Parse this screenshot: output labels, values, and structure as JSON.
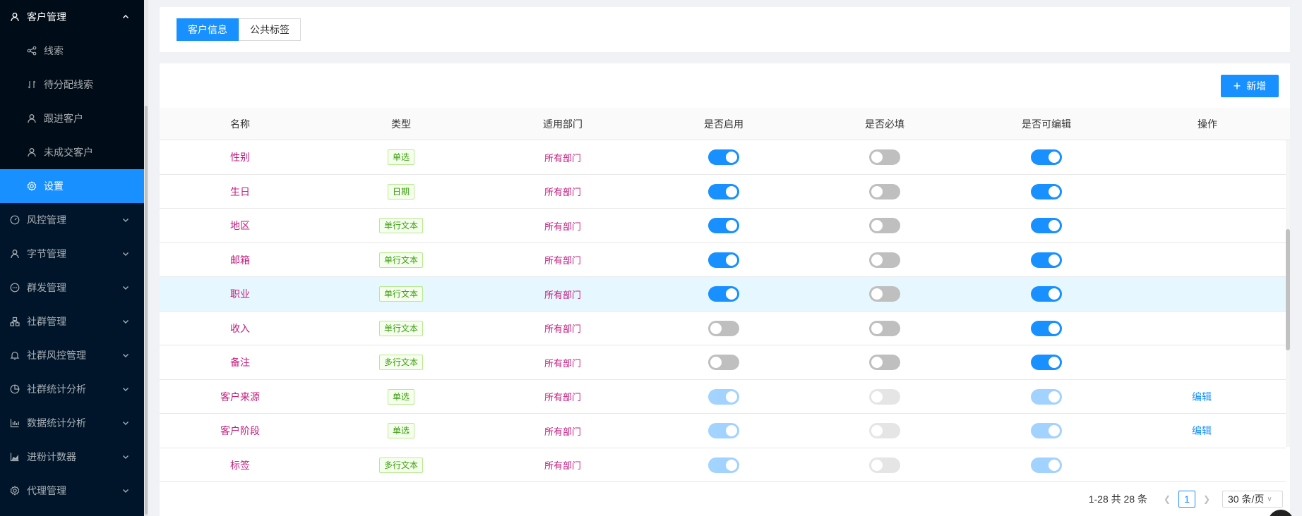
{
  "sidebar": {
    "items": [
      {
        "label": "客户管理",
        "icon": "customer-icon",
        "expanded": true
      },
      {
        "label": "线索",
        "icon": "share-icon"
      },
      {
        "label": "待分配线索",
        "icon": "swap-icon"
      },
      {
        "label": "跟进客户",
        "icon": "user-icon"
      },
      {
        "label": "未成交客户",
        "icon": "user-icon"
      },
      {
        "label": "设置",
        "icon": "gear-icon",
        "active": true
      },
      {
        "label": "风控管理",
        "icon": "dashboard-icon"
      },
      {
        "label": "字节管理",
        "icon": "user-icon"
      },
      {
        "label": "群发管理",
        "icon": "message-icon"
      },
      {
        "label": "社群管理",
        "icon": "group-icon"
      },
      {
        "label": "社群风控管理",
        "icon": "bell-icon"
      },
      {
        "label": "社群统计分析",
        "icon": "pie-chart-icon"
      },
      {
        "label": "数据统计分析",
        "icon": "bar-chart-icon"
      },
      {
        "label": "进粉计数器",
        "icon": "area-chart-icon"
      },
      {
        "label": "代理管理",
        "icon": "gear-icon"
      }
    ]
  },
  "tabs": {
    "customer_info": "客户信息",
    "public_tags": "公共标签"
  },
  "toolbar": {
    "add_label": "新增",
    "add_icon": "plus-icon"
  },
  "table": {
    "headers": [
      "名称",
      "类型",
      "适用部门",
      "是否启用",
      "是否必填",
      "是否可编辑",
      "操作"
    ],
    "rows": [
      {
        "name": "性别",
        "type": "单选",
        "dept": "所有部门",
        "enabled": true,
        "required": false,
        "editable": true,
        "disabled": false,
        "op": ""
      },
      {
        "name": "生日",
        "type": "日期",
        "dept": "所有部门",
        "enabled": true,
        "required": false,
        "editable": true,
        "disabled": false,
        "op": ""
      },
      {
        "name": "地区",
        "type": "单行文本",
        "dept": "所有部门",
        "enabled": true,
        "required": false,
        "editable": true,
        "disabled": false,
        "op": ""
      },
      {
        "name": "邮箱",
        "type": "单行文本",
        "dept": "所有部门",
        "enabled": true,
        "required": false,
        "editable": true,
        "disabled": false,
        "op": ""
      },
      {
        "name": "职业",
        "type": "单行文本",
        "dept": "所有部门",
        "enabled": true,
        "required": false,
        "editable": true,
        "disabled": false,
        "op": "",
        "hover": true
      },
      {
        "name": "收入",
        "type": "单行文本",
        "dept": "所有部门",
        "enabled": false,
        "required": false,
        "editable": true,
        "disabled": false,
        "op": ""
      },
      {
        "name": "备注",
        "type": "多行文本",
        "dept": "所有部门",
        "enabled": false,
        "required": false,
        "editable": true,
        "disabled": false,
        "op": ""
      },
      {
        "name": "客户来源",
        "type": "单选",
        "dept": "所有部门",
        "enabled": true,
        "required": false,
        "editable": true,
        "disabled": true,
        "op": "编辑"
      },
      {
        "name": "客户阶段",
        "type": "单选",
        "dept": "所有部门",
        "enabled": true,
        "required": false,
        "editable": true,
        "disabled": true,
        "op": "编辑"
      },
      {
        "name": "标签",
        "type": "多行文本",
        "dept": "所有部门",
        "enabled": true,
        "required": false,
        "editable": true,
        "disabled": true,
        "op": ""
      }
    ]
  },
  "pagination": {
    "total_text": "1-28 共 28 条",
    "current_page": "1",
    "page_size": "30 条/页",
    "prev_icon": "left-icon",
    "next_icon": "right-icon"
  },
  "colors": {
    "sidebar_bg": "#001529",
    "accent": "#1890ff",
    "name_color": "#c41d7f",
    "tag_green": "#389e0d"
  }
}
